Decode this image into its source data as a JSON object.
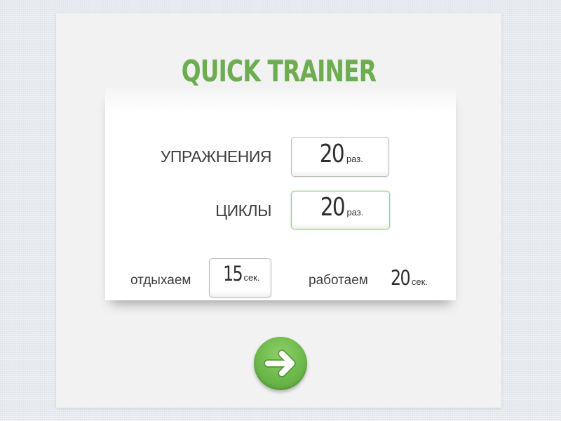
{
  "app": {
    "title": "QUICK TRAINER",
    "accent_color": "#6cae4f"
  },
  "settings": {
    "exercises": {
      "label": "УПРАЖНЕНИЯ",
      "value": "20",
      "unit": "раз."
    },
    "cycles": {
      "label": "ЦИКЛЫ",
      "value": "20",
      "unit": "раз."
    },
    "rest": {
      "label": "отдыхаем",
      "value": "15",
      "unit": "сек."
    },
    "work": {
      "label": "работаем",
      "value": "20",
      "unit": "сек."
    }
  },
  "start_button": {
    "icon": "arrow-right-icon"
  }
}
